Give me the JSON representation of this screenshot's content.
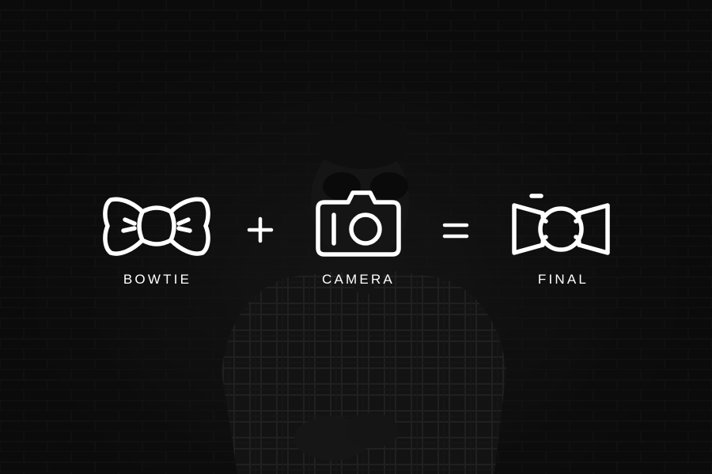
{
  "colors": {
    "background": "#121212",
    "foreground": "#ffffff"
  },
  "equation": {
    "items": [
      {
        "icon": "bowtie-icon",
        "label": "BOWTIE"
      },
      {
        "icon": "camera-icon",
        "label": "CAMERA"
      },
      {
        "icon": "bowtie-camera-logo-icon",
        "label": "FINAL"
      }
    ],
    "operators": [
      "plus-icon",
      "equals-icon"
    ]
  }
}
